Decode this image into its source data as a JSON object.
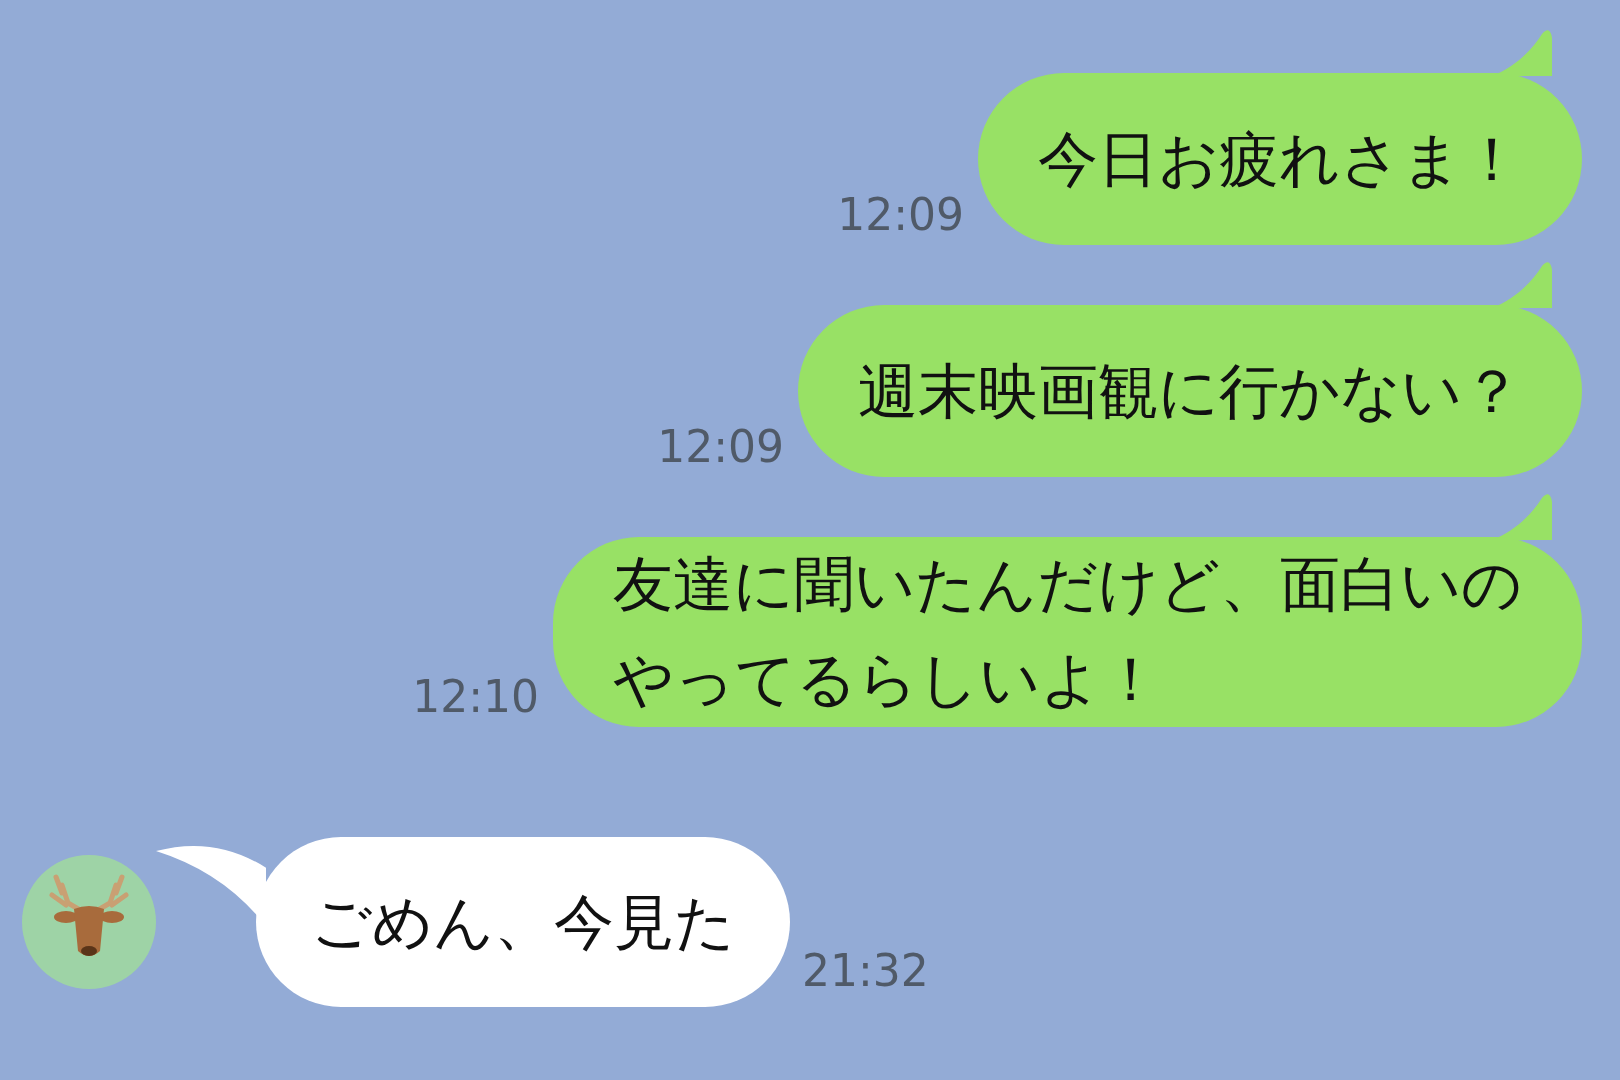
{
  "messages": [
    {
      "kind": "sent",
      "lines": [
        "今日お疲れさま！"
      ],
      "time": "12:09"
    },
    {
      "kind": "sent",
      "lines": [
        "週末映画観に行かない？"
      ],
      "time": "12:09"
    },
    {
      "kind": "sent",
      "lines": [
        "友達に聞いたんだけど、面白いの",
        "やってるらしいよ！"
      ],
      "time": "12:10"
    },
    {
      "kind": "received",
      "lines": [
        "ごめん、今見た"
      ],
      "time": "21:32"
    }
  ]
}
